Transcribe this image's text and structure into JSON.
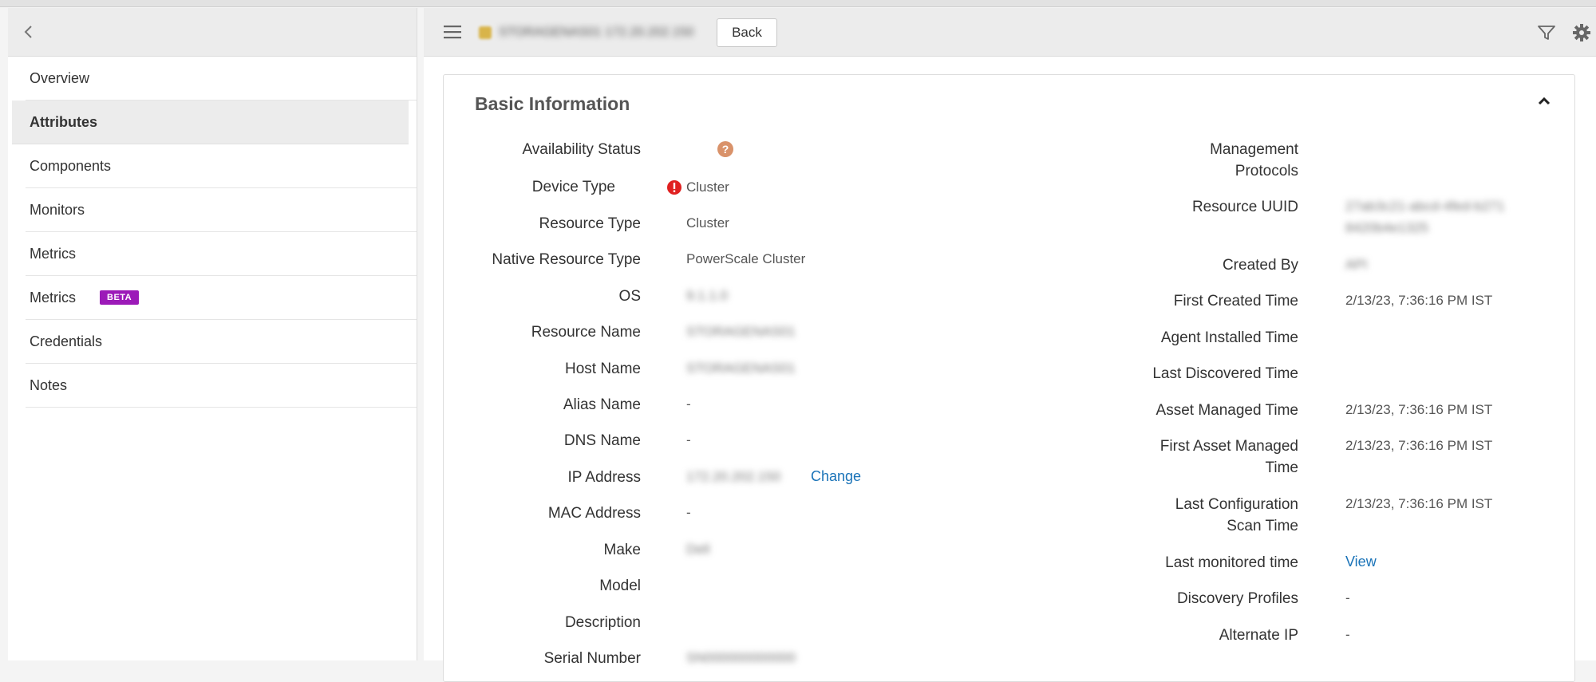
{
  "sidebar": {
    "items": [
      {
        "label": "Overview"
      },
      {
        "label": "Attributes",
        "active": true
      },
      {
        "label": "Components"
      },
      {
        "label": "Monitors"
      },
      {
        "label": "Metrics"
      },
      {
        "label": "Metrics",
        "badge": "BETA"
      },
      {
        "label": "Credentials"
      },
      {
        "label": "Notes"
      }
    ]
  },
  "toolbar": {
    "resource_name": "STORAGENAS01  172.20.202.150",
    "back_label": "Back"
  },
  "card": {
    "title": "Basic Information"
  },
  "left_fields": {
    "availability_status": {
      "label": "Availability Status"
    },
    "device_type": {
      "label": "Device Type",
      "value": "Cluster"
    },
    "resource_type": {
      "label": "Resource Type",
      "value": "Cluster"
    },
    "native_resource_type": {
      "label": "Native Resource Type",
      "value": "PowerScale Cluster"
    },
    "os": {
      "label": "OS",
      "value": "9.1.1.0"
    },
    "resource_name": {
      "label": "Resource Name",
      "value": "STORAGENAS01"
    },
    "host_name": {
      "label": "Host Name",
      "value": "STORAGENAS01"
    },
    "alias_name": {
      "label": "Alias Name",
      "value": "-"
    },
    "dns_name": {
      "label": "DNS Name",
      "value": "-"
    },
    "ip_address": {
      "label": "IP Address",
      "value": "172.20.202.150",
      "action": "Change"
    },
    "mac_address": {
      "label": "MAC Address",
      "value": "-"
    },
    "make": {
      "label": "Make",
      "value": "Dell"
    },
    "model": {
      "label": "Model"
    },
    "description": {
      "label": "Description"
    },
    "serial_number": {
      "label": "Serial Number",
      "value": "SN000000000000"
    }
  },
  "right_fields": {
    "management_protocols": {
      "label_line1": "Management",
      "label_line2": "Protocols"
    },
    "resource_uuid": {
      "label": "Resource UUID",
      "value_line1": "27ab3c21-abcd-4fed-b271",
      "value_line2": "8420b4e1325"
    },
    "created_by": {
      "label": "Created By",
      "value": "API"
    },
    "first_created_time": {
      "label": "First Created Time",
      "value": "2/13/23, 7:36:16 PM IST"
    },
    "agent_installed_time": {
      "label": "Agent Installed Time"
    },
    "last_discovered_time": {
      "label": "Last Discovered Time"
    },
    "asset_managed_time": {
      "label": "Asset Managed Time",
      "value": "2/13/23, 7:36:16 PM IST"
    },
    "first_asset_managed_time": {
      "label_line1": "First Asset Managed",
      "label_line2": "Time",
      "value": "2/13/23, 7:36:16 PM IST"
    },
    "last_configuration_scan_time": {
      "label_line1": "Last Configuration",
      "label_line2": "Scan Time",
      "value": "2/13/23, 7:36:16 PM IST"
    },
    "last_monitored_time": {
      "label": "Last monitored time",
      "action": "View"
    },
    "discovery_profiles": {
      "label": "Discovery Profiles",
      "value": "-"
    },
    "alternate_ip": {
      "label": "Alternate IP",
      "value": "-"
    }
  },
  "colors": {
    "beta_badge": "#9c1ab8",
    "link": "#1a73b8",
    "availability_icon": "#d9926a",
    "error_icon": "#e02020"
  },
  "icons": [
    "chevron-left-icon",
    "hamburger-menu-icon",
    "filter-icon",
    "gear-icon",
    "chevron-up-icon",
    "question-icon",
    "alert-icon"
  ]
}
